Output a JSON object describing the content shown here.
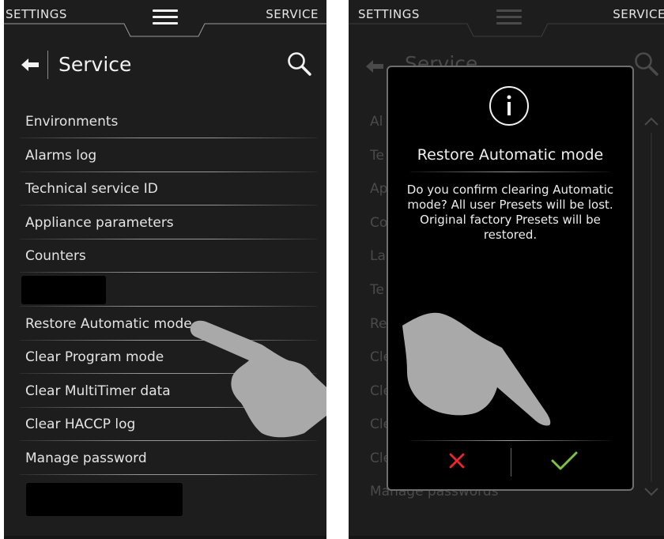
{
  "left_screen": {
    "topbar": {
      "left_label": "SETTINGS",
      "right_label": "SERVICE"
    },
    "header": {
      "title": "Service"
    },
    "items": [
      {
        "label": "Environments"
      },
      {
        "label": "Alarms log"
      },
      {
        "label": "Technical service ID"
      },
      {
        "label": "Appliance parameters"
      },
      {
        "label": "Counters"
      },
      {
        "label": ""
      },
      {
        "label": "Restore Automatic mode"
      },
      {
        "label": "Clear Program mode"
      },
      {
        "label": "Clear MultiTimer data"
      },
      {
        "label": "Clear HACCP log"
      },
      {
        "label": "Manage password"
      }
    ]
  },
  "right_screen": {
    "topbar": {
      "left_label": "SETTINGS",
      "right_label": "SERVICE"
    },
    "header": {
      "title": "Service"
    },
    "bg_items": [
      "Al",
      "Te",
      "Ap",
      "Co",
      "La",
      "Te",
      "Re",
      "Cle",
      "Cle",
      "Cle",
      "Cle",
      "Manage passwords"
    ],
    "dialog": {
      "icon": "info-icon",
      "title": "Restore Automatic mode",
      "message": "Do you confirm clearing Automatic mode? All user Presets will be lost. Original factory Presets will be restored.",
      "cancel_icon": "cross-icon",
      "confirm_icon": "check-icon",
      "colors": {
        "cancel": "#e8262b",
        "confirm": "#7fc241"
      }
    }
  },
  "icons": [
    "menu-icon",
    "back-arrow-icon",
    "search-icon",
    "hand-pointer-icon",
    "scroll-up-icon",
    "scroll-down-icon"
  ]
}
